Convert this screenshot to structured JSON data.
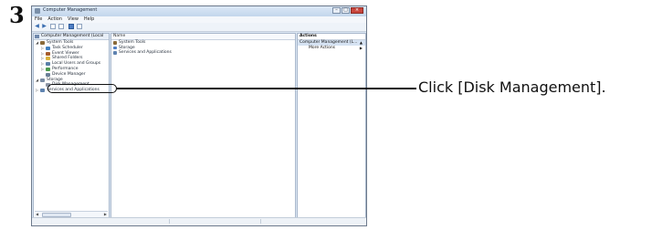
{
  "step_number": "3",
  "window": {
    "title": "Computer Management",
    "menu": [
      "File",
      "Action",
      "View",
      "Help"
    ]
  },
  "tree": {
    "root_label": "Computer Management (Local",
    "items": [
      {
        "label": "System Tools",
        "indent": 1,
        "arrow": "◢",
        "color": "#8a6b3a"
      },
      {
        "label": "Task Scheduler",
        "indent": 2,
        "arrow": "▷",
        "color": "#3f7fc0"
      },
      {
        "label": "Event Viewer",
        "indent": 2,
        "arrow": "▷",
        "color": "#a55b2b"
      },
      {
        "label": "Shared Folders",
        "indent": 2,
        "arrow": "▷",
        "color": "#d9b13a"
      },
      {
        "label": "Local Users and Groups",
        "indent": 2,
        "arrow": "▷",
        "color": "#5a7fa8"
      },
      {
        "label": "Performance",
        "indent": 2,
        "arrow": "▷",
        "color": "#4c9a4c"
      },
      {
        "label": "Device Manager",
        "indent": 2,
        "arrow": "",
        "color": "#6a7f98"
      },
      {
        "label": "Storage",
        "indent": 1,
        "arrow": "◢",
        "color": "#7a8ca4"
      },
      {
        "label": "Disk Management",
        "indent": 2,
        "arrow": "",
        "color": "#8c96a6"
      },
      {
        "label": "Services and Applications",
        "indent": 1,
        "arrow": "▷",
        "color": "#5f83b0"
      }
    ]
  },
  "content": {
    "column_header": "Name",
    "rows": [
      {
        "label": "System Tools",
        "color": "#8a6b3a"
      },
      {
        "label": "Storage",
        "color": "#4f7ec4"
      },
      {
        "label": "Services and Applications",
        "color": "#5f83b0"
      }
    ]
  },
  "actions_pane": {
    "header": "Actions",
    "section": "Computer Management (L...",
    "items": [
      "More Actions"
    ]
  },
  "callout": {
    "text": "Click [Disk Management]."
  }
}
